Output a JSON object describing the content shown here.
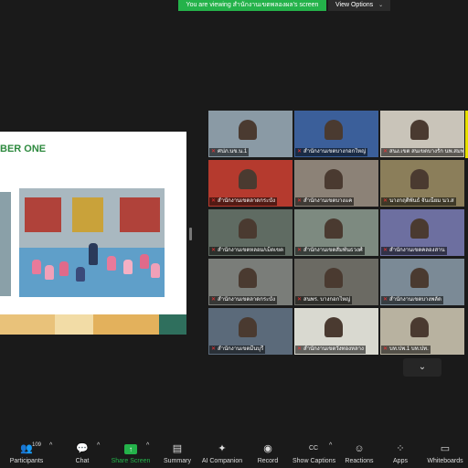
{
  "banner": {
    "text": "You are viewing สำนักงานเขตพลองผล's screen"
  },
  "view_options": {
    "label": "View Options"
  },
  "slide": {
    "title": "BER ONE"
  },
  "tiles": [
    {
      "label": "ศปภ.นข.น.1",
      "bg": "#8a9aa5"
    },
    {
      "label": "สำนักงานเขตบางกอกใหญ่",
      "bg": "#3b5f9a"
    },
    {
      "label": "สนง.เขต สนเขตบางรัก นพ.สมพง",
      "bg": "#c9c4b9"
    },
    {
      "label": "สำนักงานเขตลาดกระบัง",
      "bg": "#b53a2e"
    },
    {
      "label": "สำนักงานเขตบางแค",
      "bg": "#8c8277"
    },
    {
      "label": "นางกฤติพันธ์ จันเนียม นว.ส",
      "bg": "#8b7e5a"
    },
    {
      "label": "สำนักงานเขตหลอม/เม็ดเขต",
      "bg": "#5f6b62"
    },
    {
      "label": "สำนักงานเขตสัมพันธวงศ์",
      "bg": "#7d8a80"
    },
    {
      "label": "สำนักงานเขตคลองสาน",
      "bg": "#6d6fa0"
    },
    {
      "label": "สำนักงานเขตลาดกระบัง",
      "bg": "#7a7d79"
    },
    {
      "label": "สนพร. บางกอกใหญ่",
      "bg": "#6b6a63"
    },
    {
      "label": "สำนักงานเขตบางพลัด",
      "bg": "#7b8a96"
    },
    {
      "label": "สำนักงานเขตมีนบุรี",
      "bg": "#5b6a7a"
    },
    {
      "label": "สำนักงานเขตวังทองหลาง",
      "bg": "#d9d9d0"
    },
    {
      "label": "บท.ปพ.1 บท.ปท.",
      "bg": "#b8b2a0"
    }
  ],
  "toolbar": {
    "participants": {
      "label": "Participants",
      "count": "109"
    },
    "chat": {
      "label": "Chat"
    },
    "share_screen": {
      "label": "Share Screen"
    },
    "summary": {
      "label": "Summary"
    },
    "ai_companion": {
      "label": "AI Companion"
    },
    "record": {
      "label": "Record"
    },
    "show_captions": {
      "label": "Show Captions",
      "icon_text": "CC"
    },
    "reactions": {
      "label": "Reactions"
    },
    "apps": {
      "label": "Apps"
    },
    "whiteboards": {
      "label": "Whiteboards"
    }
  },
  "colors": {
    "accent_green": "#24b24a",
    "background": "#1a1a1a",
    "active_speaker": "#e8e000"
  }
}
